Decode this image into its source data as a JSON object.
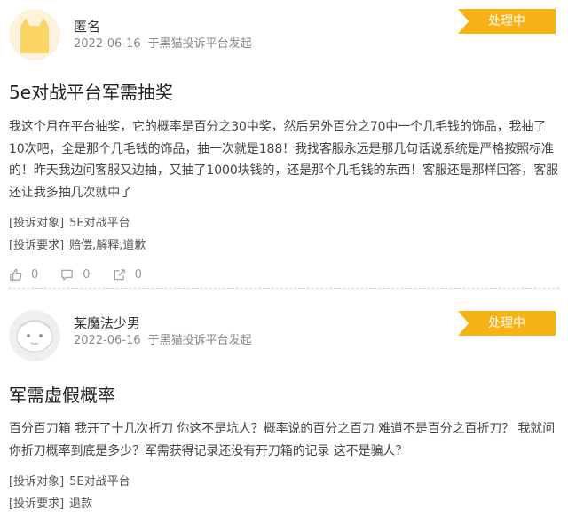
{
  "posts": [
    {
      "username": "匿名",
      "date": "2022-06-16",
      "source": "于黑猫投诉平台发起",
      "status": "处理中",
      "title": "5e对战平台军需抽奖",
      "content": "我这个月在平台抽奖，它的概率是百分之30中奖，然后另外百分之70中一个几毛钱的饰品，我抽了10次吧，全是那个几毛钱的饰品，抽一次就是188！我找客服永远是那几句话说系统是严格按照标准的！昨天我边问客服又边抽，又抽了1000块钱的，还是那个几毛钱的东西！客服还是那样回答，客服还让我多抽几次就中了",
      "target_label": "[投诉对象]",
      "target_value": "5E对战平台",
      "demand_label": "[投诉要求]",
      "demand_value": "赔偿,解释,道歉",
      "like_count": "0",
      "comment_count": "0",
      "share_count": "0"
    },
    {
      "username": "某魔法少男",
      "date": "2022-06-16",
      "source": "于黑猫投诉平台发起",
      "status": "处理中",
      "title": "军需虚假概率",
      "content": "百分百刀箱 我开了十几次折刀 你这不是坑人？概率说的百分之百刀 难道不是百分之百折刀？ 我就问你折刀概率到底是多少？军需获得记录还没有开刀箱的记录 这不是骗人？",
      "target_label": "[投诉对象]",
      "target_value": "5E对战平台",
      "demand_label": "[投诉要求]",
      "demand_value": "退款"
    }
  ],
  "colors": {
    "status_badge": "#f7b215",
    "avatar_cat": "#fad465"
  },
  "icons": {
    "like": "thumbs-up-icon",
    "comment": "comment-icon",
    "share": "share-icon"
  }
}
